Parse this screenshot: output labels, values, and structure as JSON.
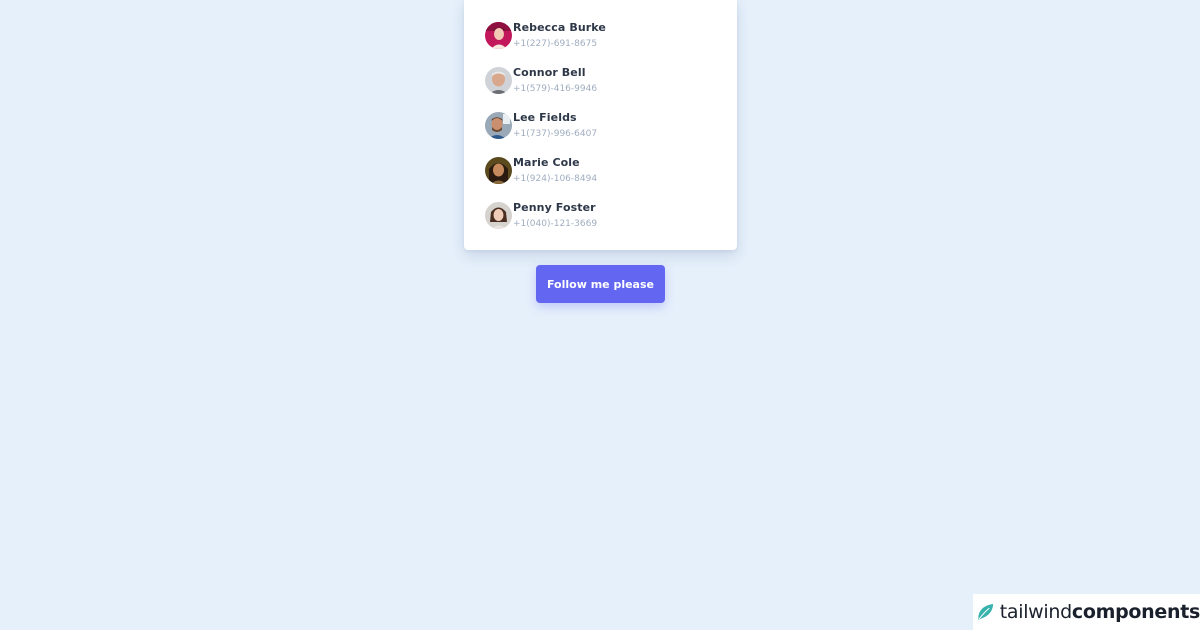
{
  "contacts": [
    {
      "name": "Rebecca Burke",
      "phone": "+1(227)-691-8675",
      "avatar": "rebecca-burke-avatar"
    },
    {
      "name": "Connor Bell",
      "phone": "+1(579)-416-9946",
      "avatar": "connor-bell-avatar"
    },
    {
      "name": "Lee Fields",
      "phone": "+1(737)-996-6407",
      "avatar": "lee-fields-avatar"
    },
    {
      "name": "Marie Cole",
      "phone": "+1(924)-106-8494",
      "avatar": "marie-cole-avatar"
    },
    {
      "name": "Penny Foster",
      "phone": "+1(040)-121-3669",
      "avatar": "penny-foster-avatar"
    }
  ],
  "follow_button": {
    "label": "Follow me please"
  },
  "brand": {
    "light": "tailwind",
    "bold": "components",
    "logo_icon": "leaf-icon"
  },
  "colors": {
    "background": "#e6f0fb",
    "card": "#ffffff",
    "button": "#6366f1",
    "name_text": "#2d3748",
    "phone_text": "#a0aec0",
    "brand_accent": "#38b2ac"
  }
}
